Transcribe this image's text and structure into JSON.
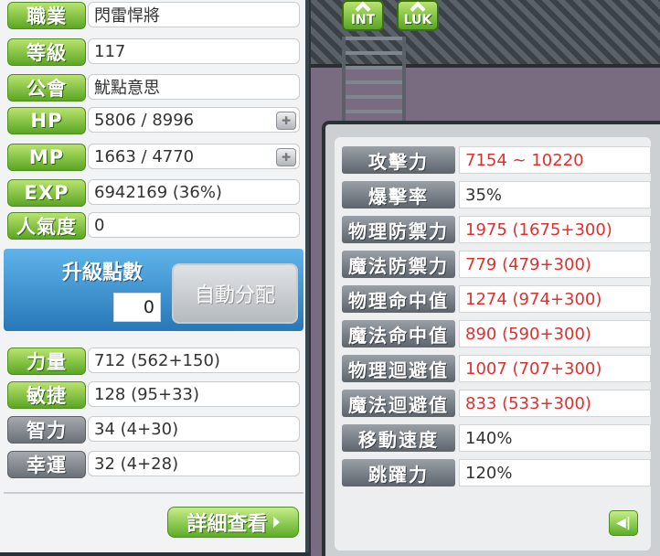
{
  "left": {
    "rows": [
      {
        "label": "職業",
        "value": "閃雷悍將",
        "style": "green"
      },
      {
        "label": "等級",
        "value": "117",
        "style": "green"
      },
      {
        "label": "公會",
        "value": "魷點意思",
        "style": "green"
      },
      {
        "label": "HP",
        "value": "5806 / 8996",
        "style": "green"
      },
      {
        "label": "MP",
        "value": "1663 / 4770",
        "style": "green"
      },
      {
        "label": "EXP",
        "value": "6942169 (36%)",
        "style": "green"
      },
      {
        "label": "人氣度",
        "value": "0",
        "style": "green"
      }
    ],
    "ap": {
      "title": "升級點數",
      "value": "0",
      "auto_label": "自動分配"
    },
    "stats": [
      {
        "label": "力量",
        "value": "712 (562+150)",
        "style": "green"
      },
      {
        "label": "敏捷",
        "value": "128 (95+33)",
        "style": "green"
      },
      {
        "label": "智力",
        "value": "34 (4+30)",
        "style": "gray"
      },
      {
        "label": "幸運",
        "value": "32 (4+28)",
        "style": "gray"
      }
    ],
    "detail_label": "詳細查看"
  },
  "top_buttons": {
    "int": "INT",
    "luk": "LUK"
  },
  "detail": {
    "rows": [
      {
        "label": "攻擊力",
        "value": "7154 ~ 10220",
        "color": "red"
      },
      {
        "label": "爆擊率",
        "value": "35%",
        "color": "dark"
      },
      {
        "label": "物理防禦力",
        "value": "1975 (1675+300)",
        "color": "red"
      },
      {
        "label": "魔法防禦力",
        "value": "779 (479+300)",
        "color": "red"
      },
      {
        "label": "物理命中值",
        "value": "1274 (974+300)",
        "color": "red"
      },
      {
        "label": "魔法命中值",
        "value": "890 (590+300)",
        "color": "red"
      },
      {
        "label": "物理迴避值",
        "value": "1007 (707+300)",
        "color": "red"
      },
      {
        "label": "魔法迴避值",
        "value": "833 (533+300)",
        "color": "red"
      },
      {
        "label": "移動速度",
        "value": "140%",
        "color": "dark"
      },
      {
        "label": "跳躍力",
        "value": "120%",
        "color": "dark"
      }
    ]
  }
}
